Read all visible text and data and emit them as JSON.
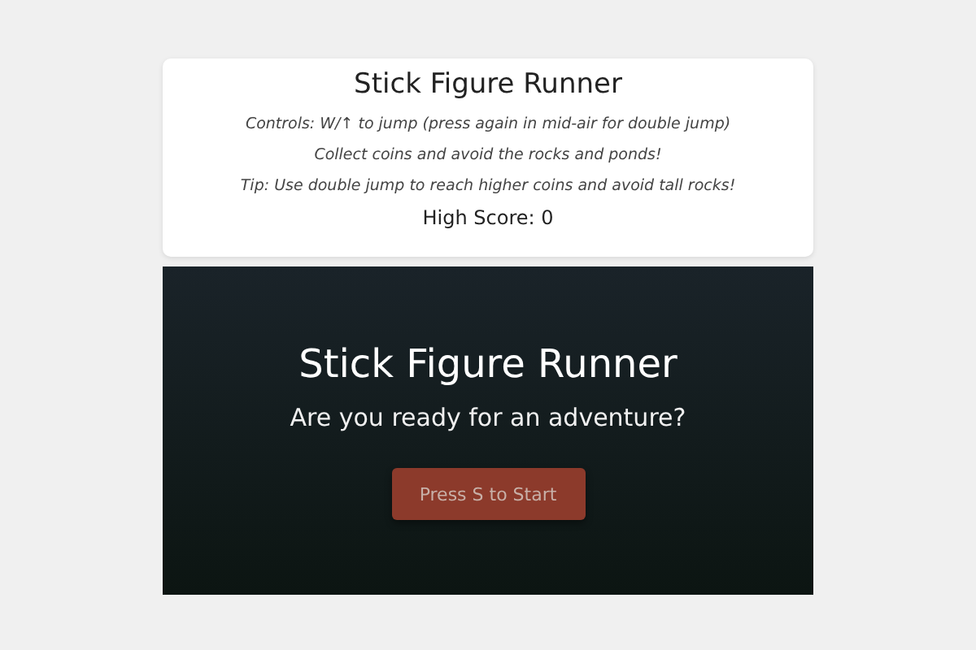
{
  "info_card": {
    "title": "Stick Figure Runner",
    "lines": [
      "Controls: W/↑ to jump (press again in mid-air for double jump)",
      "Collect coins and avoid the rocks and ponds!",
      "Tip: Use double jump to reach higher coins and avoid tall rocks!"
    ],
    "high_score": "High Score: 0"
  },
  "start_screen": {
    "title": "Stick Figure Runner",
    "subtitle": "Are you ready for an adventure?",
    "button": "Press S to Start"
  }
}
